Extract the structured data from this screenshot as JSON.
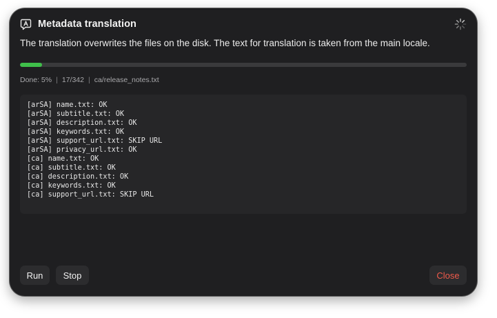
{
  "dialog": {
    "title": "Metadata translation",
    "title_icon": "translate-bubble-icon",
    "spinner_icon": "loading-spinner-icon",
    "description": "The translation overwrites the files on the disk. The text for translation is taken from the main locale."
  },
  "progress": {
    "percent": 5,
    "fill_color": "#3fbf4a",
    "done_text": "Done: 5%",
    "count_text": "17/342",
    "current_file": "ca/release_notes.txt",
    "separator": "|"
  },
  "log": {
    "lines": [
      "[arSA] name.txt: OK",
      "[arSA] subtitle.txt: OK",
      "[arSA] description.txt: OK",
      "[arSA] keywords.txt: OK",
      "[arSA] support_url.txt: SKIP URL",
      "[arSA] privacy_url.txt: OK",
      "[ca] name.txt: OK",
      "[ca] subtitle.txt: OK",
      "[ca] description.txt: OK",
      "[ca] keywords.txt: OK",
      "[ca] support_url.txt: SKIP URL"
    ]
  },
  "buttons": {
    "run": "Run",
    "stop": "Stop",
    "close": "Close",
    "close_color": "#f05a4a"
  }
}
